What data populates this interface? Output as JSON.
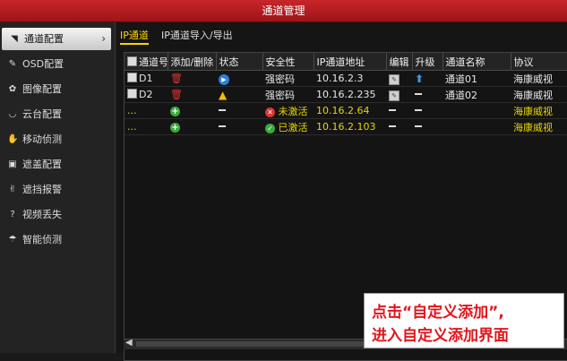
{
  "window": {
    "title": "通道管理"
  },
  "sidebar": {
    "items": [
      {
        "label": "通道配置",
        "icon": "camera-icon",
        "active": true
      },
      {
        "label": "OSD配置",
        "icon": "osd-icon"
      },
      {
        "label": "图像配置",
        "icon": "image-icon"
      },
      {
        "label": "云台配置",
        "icon": "ptz-icon"
      },
      {
        "label": "移动侦测",
        "icon": "motion-icon"
      },
      {
        "label": "遮盖配置",
        "icon": "mask-icon"
      },
      {
        "label": "遮挡报警",
        "icon": "tamper-icon"
      },
      {
        "label": "视频丢失",
        "icon": "video-loss-icon"
      },
      {
        "label": "智能侦测",
        "icon": "smart-detection-icon"
      }
    ]
  },
  "tabs": [
    {
      "label": "IP通道",
      "active": true
    },
    {
      "label": "IP通道导入/导出"
    }
  ],
  "table": {
    "headers": [
      "通道号",
      "添加/删除",
      "状态",
      "安全性",
      "IP通道地址",
      "编辑",
      "升级",
      "通道名称",
      "协议"
    ],
    "rows": [
      {
        "channel": "D1",
        "security": "强密码",
        "ip": "10.16.2.3",
        "name": "通道01",
        "protocol": "海康威视"
      },
      {
        "channel": "D2",
        "security": "强密码",
        "ip": "10.16.2.235",
        "name": "通道02",
        "protocol": "海康威视"
      },
      {
        "channel": "...",
        "security": "未激活",
        "ip": "10.16.2.64",
        "name": "",
        "protocol": "海康威视"
      },
      {
        "channel": "...",
        "security": "已激活",
        "ip": "10.16.2.103",
        "name": "",
        "protocol": "海康威视"
      }
    ]
  },
  "callout": {
    "line1": "点击“自定义添加”,",
    "line2": "进入自定义添加界面"
  },
  "colors": {
    "title_bar": "#b81c21",
    "accent_tab": "#ffd400",
    "inactive_text": "#e6d500",
    "callout_text": "#e0161c"
  }
}
